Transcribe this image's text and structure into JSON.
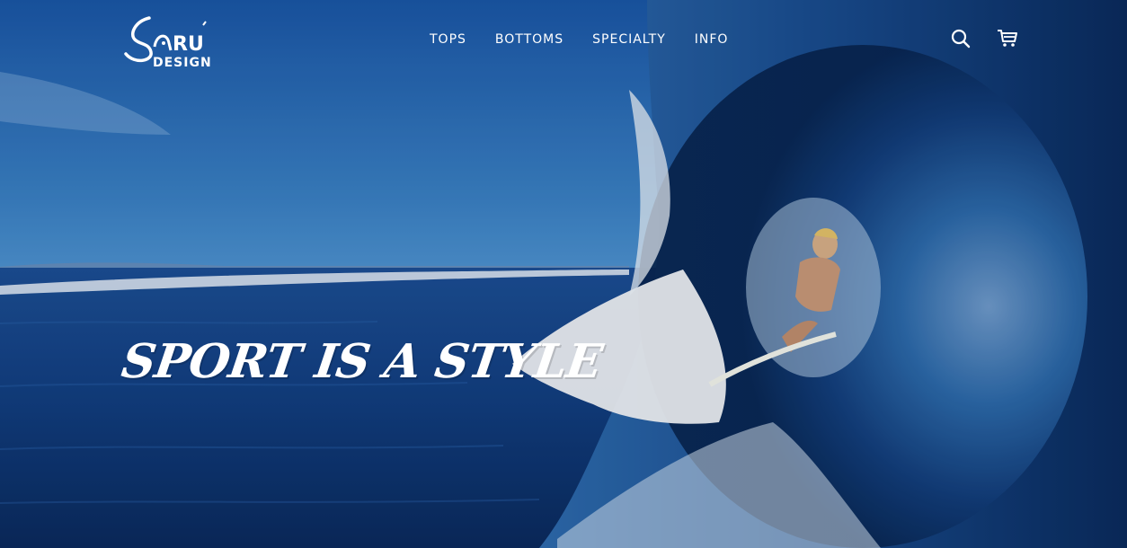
{
  "brand": {
    "name_line1": "SARU",
    "name_line2": "DESIGN"
  },
  "nav": {
    "items": [
      {
        "label": "TOPS"
      },
      {
        "label": "BOTTOMS"
      },
      {
        "label": "SPECIALTY"
      },
      {
        "label": "INFO"
      }
    ]
  },
  "header_icons": {
    "search": "search-icon",
    "cart": "cart-icon"
  },
  "hero": {
    "tagline": "SPORT IS A STYLE"
  },
  "colors": {
    "sky_top": "#1f5fae",
    "sky_horizon": "#3f86c8",
    "ocean_deep": "#0e2f6a",
    "wave_dark": "#0b2e66",
    "foam": "#f4f7fb",
    "text": "#ffffff"
  }
}
